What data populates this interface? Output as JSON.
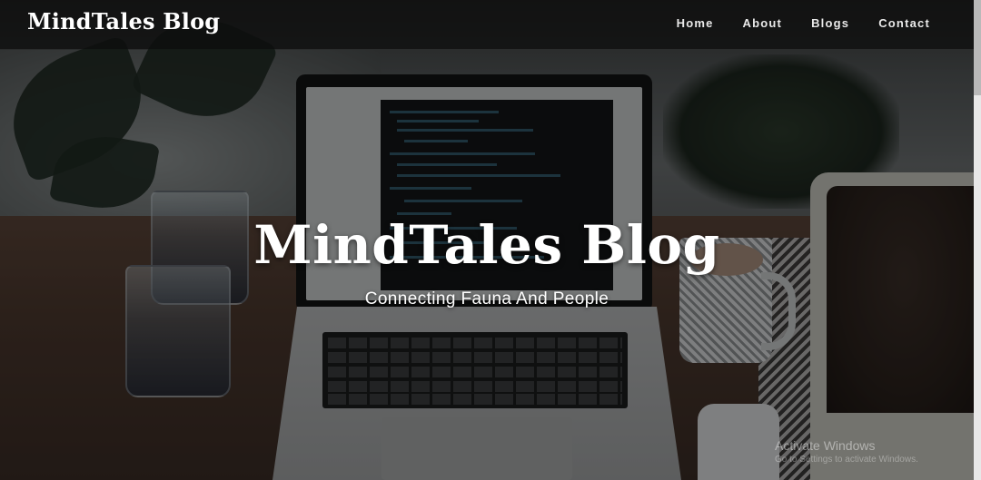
{
  "navbar": {
    "brand": "MindTales Blog",
    "links": [
      {
        "label": "Home"
      },
      {
        "label": "About"
      },
      {
        "label": "Blogs"
      },
      {
        "label": "Contact"
      }
    ]
  },
  "hero": {
    "title": "MindTales Blog",
    "subtitle": "Connecting Fauna And People"
  },
  "watermark": {
    "line1": "Activate Windows",
    "line2": "Go to Settings to activate Windows."
  },
  "colors": {
    "navbar_bg": "#0c0c0c",
    "text": "#ffffff"
  }
}
